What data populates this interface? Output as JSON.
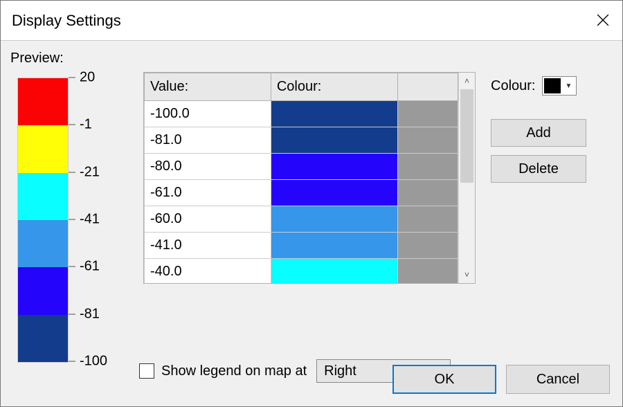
{
  "window": {
    "title": "Display Settings",
    "preview_label": "Preview:",
    "ok_label": "OK",
    "cancel_label": "Cancel"
  },
  "legend": {
    "ticks": [
      20,
      -1,
      -21,
      -41,
      -61,
      -81,
      -100
    ],
    "segments": [
      "#fb0305",
      "#fffe07",
      "#08feff",
      "#3596ea",
      "#2404fb",
      "#133c8c"
    ]
  },
  "table": {
    "header_value": "Value:",
    "header_colour": "Colour:",
    "rows": [
      {
        "value": "-100.0",
        "colour": "#133c8c"
      },
      {
        "value": "-81.0",
        "colour": "#133c8c"
      },
      {
        "value": "-80.0",
        "colour": "#2404fb"
      },
      {
        "value": "-61.0",
        "colour": "#2404fb"
      },
      {
        "value": "-60.0",
        "colour": "#3596ea"
      },
      {
        "value": "-41.0",
        "colour": "#3596ea"
      },
      {
        "value": "-40.0",
        "colour": "#08feff"
      }
    ]
  },
  "right": {
    "colour_label": "Colour:",
    "picker_colour": "#000000",
    "add_label": "Add",
    "delete_label": "Delete"
  },
  "show_legend": {
    "checked": false,
    "label": "Show legend on map at",
    "position": "Right"
  }
}
